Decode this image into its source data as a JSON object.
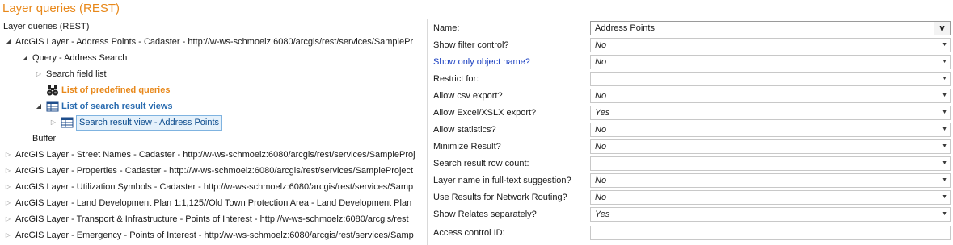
{
  "page": {
    "title": "Layer queries (REST)"
  },
  "tree": {
    "header": "Layer queries (REST)",
    "nodes": [
      {
        "label": "ArcGIS Layer - Address Points - Cadaster - http://w-ws-schmoelz:6080/arcgis/rest/services/SamplePr",
        "expanded": true
      },
      {
        "label": "Query - Address Search",
        "expanded": true
      },
      {
        "label": "Search field list",
        "expanded": false
      },
      {
        "label": "List of predefined queries",
        "icon": "binoculars-icon"
      },
      {
        "label": "List of search result views",
        "expanded": true,
        "icon": "table-icon"
      },
      {
        "label": "Search result view - Address Points",
        "expanded": false,
        "icon": "table-icon",
        "selected": true
      },
      {
        "label": "Buffer"
      },
      {
        "label": "ArcGIS Layer - Street Names - Cadaster - http://w-ws-schmoelz:6080/arcgis/rest/services/SampleProj",
        "expanded": false
      },
      {
        "label": "ArcGIS Layer - Properties - Cadaster - http://w-ws-schmoelz:6080/arcgis/rest/services/SampleProject",
        "expanded": false
      },
      {
        "label": "ArcGIS Layer - Utilization Symbols - Cadaster - http://w-ws-schmoelz:6080/arcgis/rest/services/Samp",
        "expanded": false
      },
      {
        "label": "ArcGIS Layer - Land Development Plan 1:1,125//Old Town Protection Area - Land Development Plan",
        "expanded": false
      },
      {
        "label": "ArcGIS Layer - Transport & Infrastructure - Points of Interest - http://w-ws-schmoelz:6080/arcgis/rest",
        "expanded": false
      },
      {
        "label": "ArcGIS Layer - Emergency - Points of Interest - http://w-ws-schmoelz:6080/arcgis/rest/services/Samp",
        "expanded": false
      }
    ]
  },
  "properties": {
    "name": {
      "label": "Name:",
      "value": "Address Points",
      "button": "v"
    },
    "rows": [
      {
        "label": "Show filter control?",
        "value": "No"
      },
      {
        "label": "Show only object name?",
        "value": "No",
        "link": true
      },
      {
        "label": "Restrict for:",
        "value": ""
      },
      {
        "label": "Allow csv export?",
        "value": "No"
      },
      {
        "label": "Allow Excel/XSLX export?",
        "value": "Yes"
      },
      {
        "label": "Allow statistics?",
        "value": "No"
      },
      {
        "label": "Minimize Result?",
        "value": "No"
      },
      {
        "label": "Search result row count:",
        "value": ""
      },
      {
        "label": "Layer name in full-text suggestion?",
        "value": "No"
      },
      {
        "label": "Use Results for Network Routing?",
        "value": "No"
      },
      {
        "label": "Show Relates separately?",
        "value": "Yes"
      },
      {
        "label": "Access control ID:",
        "value": ""
      }
    ]
  },
  "icons": {
    "expanded": "triangle-down-right",
    "collapsed": "triangle-right-outline"
  },
  "colors": {
    "title_orange": "#e8881a",
    "link_blue": "#1a3fc1",
    "node_blue": "#2a6cb0",
    "selection_bg": "#e5f1fb",
    "selection_border": "#7fb3e0"
  }
}
